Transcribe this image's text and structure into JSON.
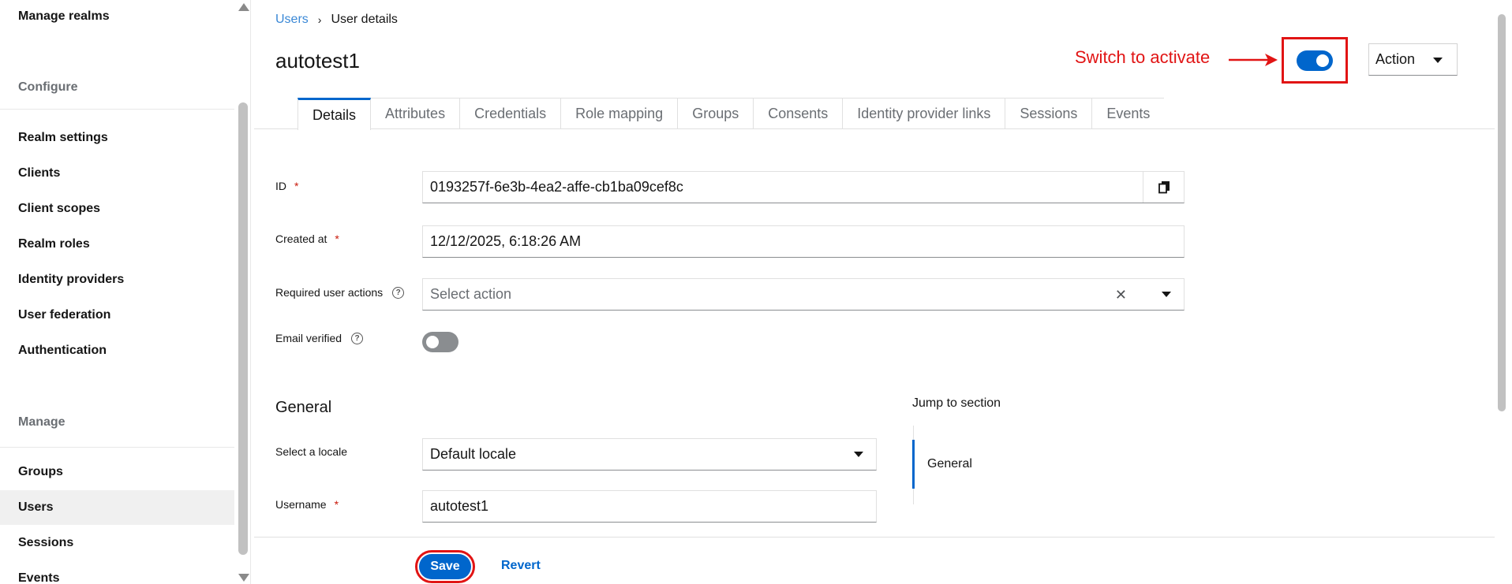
{
  "sidebar": {
    "manage_realms": "Manage realms",
    "configure_heading": "Configure",
    "configure_items": [
      "Realm settings",
      "Clients",
      "Client scopes",
      "Realm roles",
      "Identity providers",
      "User federation",
      "Authentication"
    ],
    "manage_heading": "Manage",
    "manage_items": [
      "Groups",
      "Users",
      "Sessions",
      "Events"
    ],
    "active_item": "Users"
  },
  "breadcrumb": {
    "parent": "Users",
    "separator": "›",
    "current": "User details"
  },
  "page": {
    "title": "autotest1"
  },
  "annotation": {
    "text": "Switch to activate",
    "color": "#e11414"
  },
  "header_toggle": {
    "enabled": true
  },
  "action_menu": {
    "label": "Action"
  },
  "tabs": [
    "Details",
    "Attributes",
    "Credentials",
    "Role mapping",
    "Groups",
    "Consents",
    "Identity provider links",
    "Sessions",
    "Events"
  ],
  "active_tab": "Details",
  "form": {
    "id": {
      "label": "ID",
      "required": "*",
      "value": "0193257f-6e3b-4ea2-affe-cb1ba09cef8c"
    },
    "created_at": {
      "label": "Created at",
      "required": "*",
      "value": "12/12/2025, 6:18:26 AM"
    },
    "required_actions": {
      "label": "Required user actions",
      "placeholder": "Select action"
    },
    "email_verified": {
      "label": "Email verified",
      "enabled": false
    }
  },
  "general": {
    "title": "General",
    "locale": {
      "label": "Select a locale",
      "value": "Default locale"
    },
    "username": {
      "label": "Username",
      "required": "*",
      "value": "autotest1"
    }
  },
  "jump_to_section": {
    "title": "Jump to section",
    "items": [
      "General"
    ]
  },
  "footer": {
    "save_label": "Save",
    "revert_label": "Revert"
  },
  "colors": {
    "primary": "#0066cc",
    "link": "#3a88d6",
    "annotation": "#e11414",
    "required": "#c9190b"
  }
}
